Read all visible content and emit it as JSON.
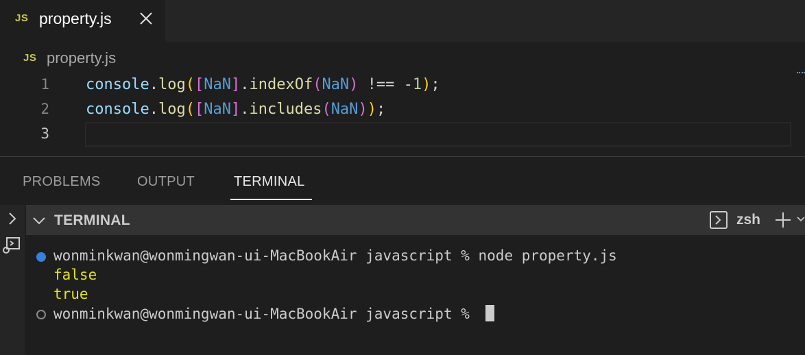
{
  "tab": {
    "badge": "JS",
    "filename": "property.js"
  },
  "breadcrumb": {
    "badge": "JS",
    "filename": "property.js"
  },
  "editor": {
    "line_numbers": [
      "1",
      "2",
      "3"
    ],
    "line1": {
      "obj": "console",
      "dot": ".",
      "fn": "log",
      "open1": "(",
      "open2": "[",
      "arg": "NaN",
      "close2": "]",
      "dot2": ".",
      "method": "indexOf",
      "open3": "(",
      "arg2": "NaN",
      "close3": ")",
      "op": " !== -",
      "num": "1",
      "close1": ")",
      "semi": ";"
    },
    "line2": {
      "obj": "console",
      "dot": ".",
      "fn": "log",
      "open1": "(",
      "open2": "[",
      "arg": "NaN",
      "close2": "]",
      "dot2": ".",
      "method": "includes",
      "open3": "(",
      "arg2": "NaN",
      "close3": ")",
      "close1": ")",
      "semi": ";"
    }
  },
  "panel": {
    "tabs": [
      {
        "label": "PROBLEMS"
      },
      {
        "label": "OUTPUT"
      },
      {
        "label": "TERMINAL"
      }
    ],
    "active_tab": "TERMINAL"
  },
  "terminal": {
    "header_title": "TERMINAL",
    "shell": "zsh",
    "lines": [
      {
        "kind": "prompt",
        "text": "wonminkwan@wonmingwan-ui-MacBookAir javascript % node property.js"
      },
      {
        "kind": "out",
        "text": "false"
      },
      {
        "kind": "out",
        "text": "true"
      },
      {
        "kind": "prompt",
        "text": "wonminkwan@wonmingwan-ui-MacBookAir javascript % "
      }
    ]
  },
  "colors": {
    "editor_bg": "#1e1e1e",
    "tab_bar_bg": "#252526",
    "js_badge": "#cbcb41",
    "output_yellow": "#e5e510",
    "accent_blue": "#3794ff"
  },
  "icons": {
    "tab_close": "close-icon",
    "panel_expand": "chevron-right-icon",
    "panel_run": "run-debug-icon",
    "terminal_collapse": "chevron-down-icon",
    "shell": "terminal-shell-icon",
    "new_terminal": "plus-icon",
    "more": "chevron-down-icon"
  }
}
